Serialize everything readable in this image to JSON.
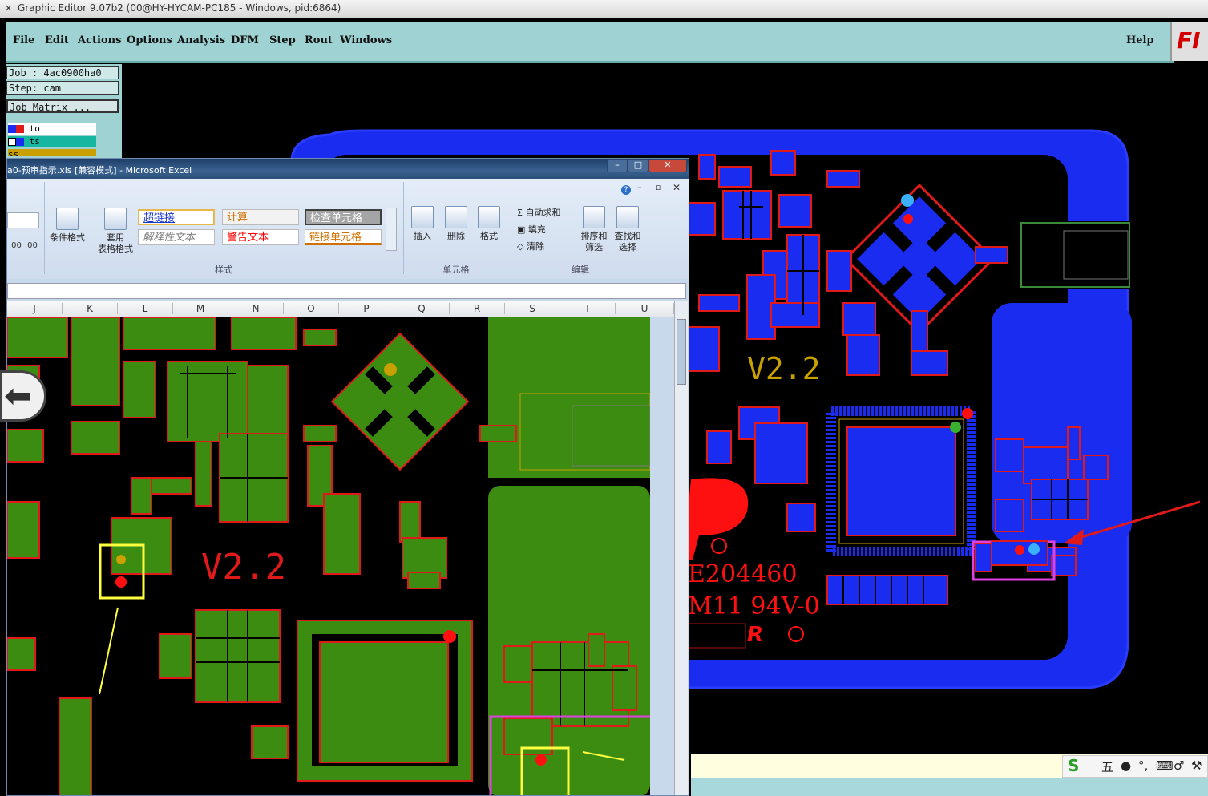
{
  "titlebar": {
    "title": "Graphic Editor 9.07b2 (00@HY-HYCAM-PC185 - Windows, pid:6864)",
    "icon": "x-icon"
  },
  "menubar": {
    "items": [
      "File",
      "Edit",
      "Actions",
      "Options",
      "Analysis",
      "DFM",
      "Step",
      "Rout",
      "Windows"
    ],
    "help": "Help",
    "logo_text": "FI"
  },
  "info": {
    "job": "Job : 4ac0900ha0",
    "step": "Step: cam",
    "matrix": "Job Matrix ..."
  },
  "layers": [
    "to",
    "ts",
    "ss"
  ],
  "excel": {
    "title": "a0-预审指示.xls [兼容模式] - Microsoft Excel",
    "buttons": {
      "minimize": "–",
      "maximize": "□",
      "close": "✕"
    },
    "ribbon": {
      "cond_format": "条件格式",
      "table_format_1": "套用",
      "table_format_2": "表格格式",
      "styles": [
        "超链接",
        "计算",
        "检查单元格",
        "解释性文本",
        "警告文本",
        "链接单元格"
      ],
      "insert": "插入",
      "delete": "删除",
      "format": "格式",
      "autosum": "自动求和",
      "fill": "填充",
      "clear": "清除",
      "sort1": "排序和",
      "sort2": "筛选",
      "find1": "查找和",
      "find2": "选择",
      "groups": {
        "styles": "样式",
        "cells": "单元格",
        "editing": "编辑"
      },
      "number_formats": [
        ".00",
        ".00"
      ]
    },
    "columns": [
      "J",
      "K",
      "L",
      "M",
      "N",
      "O",
      "P",
      "Q",
      "R",
      "S",
      "T",
      "U"
    ],
    "pcb_text": "V2.2"
  },
  "pcb": {
    "version": "V2.2",
    "mark_1": "E204460",
    "mark_2": "M11 94V-0",
    "ul": "R",
    "ul2": "R"
  },
  "ime": {
    "logo": "S",
    "chars": [
      "五",
      "●",
      "°,",
      "⌨",
      "♂",
      "⚒"
    ]
  },
  "colors": {
    "board": "#1a2cf0",
    "copper_green": "#3d8c12",
    "outline_red": "#e01a1a",
    "menu": "#9fd3d3"
  }
}
